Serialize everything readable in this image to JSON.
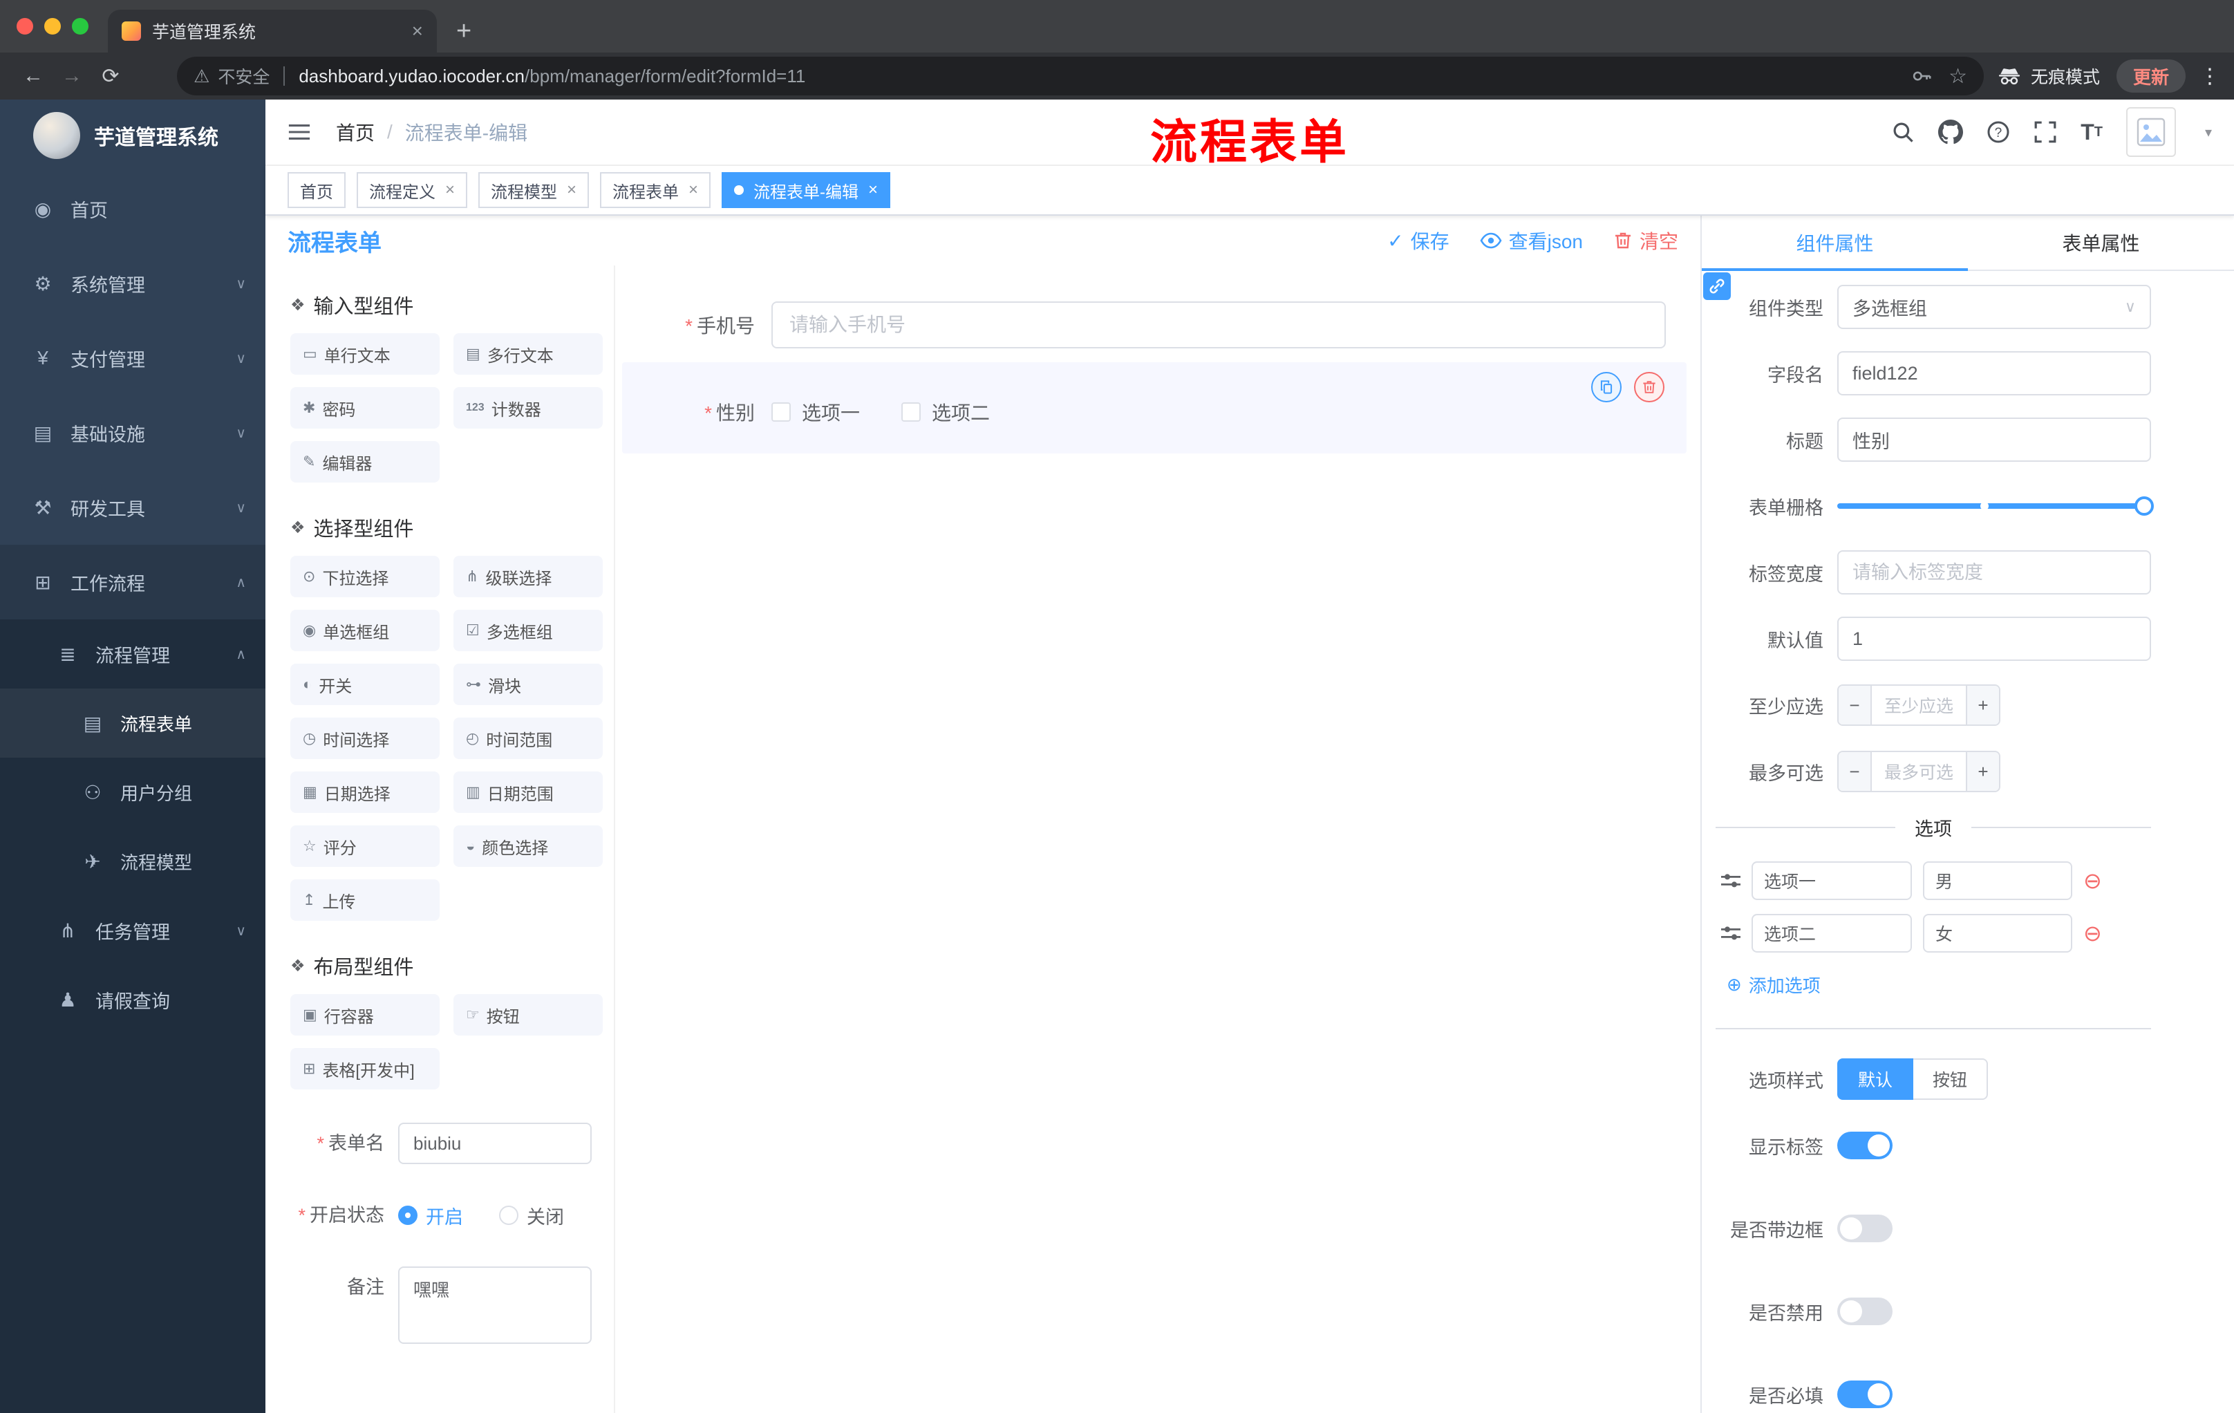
{
  "browser": {
    "tab": {
      "title": "芋道管理系统",
      "close": "×",
      "new_tab": "+"
    },
    "toolbar": {
      "back": "←",
      "forward": "→",
      "reload": "⟳",
      "security_warn": "⚠",
      "security_label": "不安全",
      "url_host": "dashboard.yudao.iocoder.cn",
      "url_path": "/bpm/manager/form/edit?formId=11",
      "bookmark_star": "☆",
      "incognito_label": "无痕模式",
      "update_label": "更新",
      "menu_dots": "⋮"
    }
  },
  "sidebar": {
    "logo_title": "芋道管理系统",
    "items": [
      {
        "glyph": "◉",
        "label": "首页"
      },
      {
        "glyph": "⚙",
        "label": "系统管理",
        "chev": "∨"
      },
      {
        "glyph": "¥",
        "label": "支付管理",
        "chev": "∨"
      },
      {
        "glyph": "▤",
        "label": "基础设施",
        "chev": "∨"
      },
      {
        "glyph": "⚒",
        "label": "研发工具",
        "chev": "∨"
      },
      {
        "glyph": "⊞",
        "label": "工作流程",
        "chev": "∧"
      },
      {
        "glyph": "≣",
        "label": "流程管理",
        "chev": "∧"
      },
      {
        "glyph": "▤",
        "label": "流程表单"
      },
      {
        "glyph": "⚇",
        "label": "用户分组"
      },
      {
        "glyph": "✈",
        "label": "流程模型"
      },
      {
        "glyph": "⋔",
        "label": "任务管理",
        "chev": "∨"
      },
      {
        "glyph": "♟",
        "label": "请假查询"
      }
    ]
  },
  "header": {
    "breadcrumb": {
      "home": "首页",
      "sep": "/",
      "current": "流程表单-编辑"
    },
    "annotation": "流程表单",
    "caret": "▾"
  },
  "tags": [
    {
      "label": "首页"
    },
    {
      "label": "流程定义",
      "close": "×"
    },
    {
      "label": "流程模型",
      "close": "×"
    },
    {
      "label": "流程表单",
      "close": "×"
    },
    {
      "label": "流程表单-编辑",
      "close": "×"
    }
  ],
  "designer": {
    "title": "流程表单",
    "actions": {
      "save_icon": "✓",
      "save": "保存",
      "view_json": "查看json",
      "clear": "清空"
    },
    "palette": {
      "sections": [
        {
          "glyph": "❖",
          "title": "输入型组件",
          "items": [
            {
              "glyph": "▭",
              "label": "单行文本"
            },
            {
              "glyph": "▤",
              "label": "多行文本"
            },
            {
              "glyph": "✱",
              "label": "密码"
            },
            {
              "glyph": "123",
              "label": "计数器"
            },
            {
              "glyph": "✎",
              "label": "编辑器"
            }
          ]
        },
        {
          "glyph": "❖",
          "title": "选择型组件",
          "items": [
            {
              "glyph": "⊙",
              "label": "下拉选择"
            },
            {
              "glyph": "⋔",
              "label": "级联选择"
            },
            {
              "glyph": "◉",
              "label": "单选框组"
            },
            {
              "glyph": "☑",
              "label": "多选框组"
            },
            {
              "glyph": "◐",
              "label": "开关"
            },
            {
              "glyph": "⊶",
              "label": "滑块"
            },
            {
              "glyph": "◷",
              "label": "时间选择"
            },
            {
              "glyph": "◴",
              "label": "时间范围"
            },
            {
              "glyph": "▦",
              "label": "日期选择"
            },
            {
              "glyph": "▥",
              "label": "日期范围"
            },
            {
              "glyph": "☆",
              "label": "评分"
            },
            {
              "glyph": "◒",
              "label": "颜色选择"
            },
            {
              "glyph": "↥",
              "label": "上传"
            }
          ]
        },
        {
          "glyph": "❖",
          "title": "布局型组件",
          "items": [
            {
              "glyph": "▣",
              "label": "行容器"
            },
            {
              "glyph": "☞",
              "label": "按钮"
            },
            {
              "glyph": "⊞",
              "label": "表格[开发中]"
            }
          ]
        }
      ],
      "meta": {
        "name_label": "表单名",
        "name_value": "biubiu",
        "status_label": "开启状态",
        "status_on": "开启",
        "status_off": "关闭",
        "remark_label": "备注",
        "remark_value": "嘿嘿"
      }
    },
    "canvas": {
      "phone_label": "手机号",
      "phone_placeholder": "请输入手机号",
      "gender_label": "性别",
      "gender_options": [
        {
          "label": "选项一"
        },
        {
          "label": "选项二"
        }
      ]
    },
    "props": {
      "tabs": {
        "component": "组件属性",
        "form": "表单属性"
      },
      "component_type_label": "组件类型",
      "component_type_value": "多选框组",
      "field_name_label": "字段名",
      "field_name_value": "field122",
      "title_label": "标题",
      "title_value": "性别",
      "grid_label": "表单栅格",
      "label_width_label": "标签宽度",
      "label_width_placeholder": "请输入标签宽度",
      "default_label": "默认值",
      "default_value": "1",
      "min_label": "至少应选",
      "min_placeholder": "至少应选",
      "max_label": "最多可选",
      "max_placeholder": "最多可选",
      "minus": "−",
      "plus": "+",
      "options_divider": "选项",
      "options": [
        {
          "label": "选项一",
          "value": "男"
        },
        {
          "label": "选项二",
          "value": "女"
        }
      ],
      "remove_glyph": "⊖",
      "add_glyph": "⊕",
      "add_option": "添加选项",
      "style_label": "选项样式",
      "style_default": "默认",
      "style_button": "按钮",
      "toggles": [
        {
          "label": "显示标签",
          "on": "true"
        },
        {
          "label": "是否带边框",
          "on": "false"
        },
        {
          "label": "是否禁用",
          "on": "false"
        },
        {
          "label": "是否必填",
          "on": "true"
        }
      ]
    }
  },
  "colors": {
    "accent": "#409eff",
    "danger": "#f56c6c",
    "annotation": "#fe0000",
    "sidebar_bg": "#304156",
    "submenu_bg": "#1f2d3d",
    "active_tag": "#409eff"
  }
}
